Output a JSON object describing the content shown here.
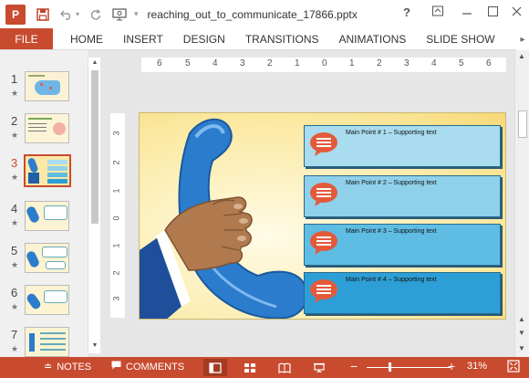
{
  "titlebar": {
    "app_letter": "P",
    "doc_title": "reaching_out_to_communicate_17866.pptx",
    "help": "?",
    "dropdown": "▾"
  },
  "ribbon": {
    "file": "FILE",
    "tabs": [
      "HOME",
      "INSERT",
      "DESIGN",
      "TRANSITIONS",
      "ANIMATIONS",
      "SLIDE SHOW"
    ],
    "more": "▸"
  },
  "thumbnails": [
    {
      "num": "1",
      "star": "★"
    },
    {
      "num": "2",
      "star": "★"
    },
    {
      "num": "3",
      "star": "★"
    },
    {
      "num": "4",
      "star": "★"
    },
    {
      "num": "5",
      "star": "★"
    },
    {
      "num": "6",
      "star": "★"
    },
    {
      "num": "7",
      "star": "★"
    }
  ],
  "rulers": {
    "horizontal": [
      "6",
      "5",
      "4",
      "3",
      "2",
      "1",
      "0",
      "1",
      "2",
      "3",
      "4",
      "5",
      "6"
    ],
    "vertical": [
      "3",
      "2",
      "1",
      "0",
      "1",
      "2",
      "3"
    ]
  },
  "slide": {
    "points": [
      "Main Point # 1 – Supporting text",
      "Main Point # 2 – Supporting text",
      "Main Point # 3 – Supporting text",
      "Main Point # 4 – Supporting text"
    ],
    "bar_colors": [
      "#a9dcee",
      "#8fd0ea",
      "#5fbde4",
      "#2d9fd6"
    ],
    "bubble_color": "#e35a3b",
    "phone_color": "#2b7ccc"
  },
  "statusbar": {
    "notes": "NOTES",
    "comments": "COMMENTS",
    "zoom": "31%",
    "minus": "−",
    "plus": "+",
    "bg_color": "#c84b2f"
  }
}
